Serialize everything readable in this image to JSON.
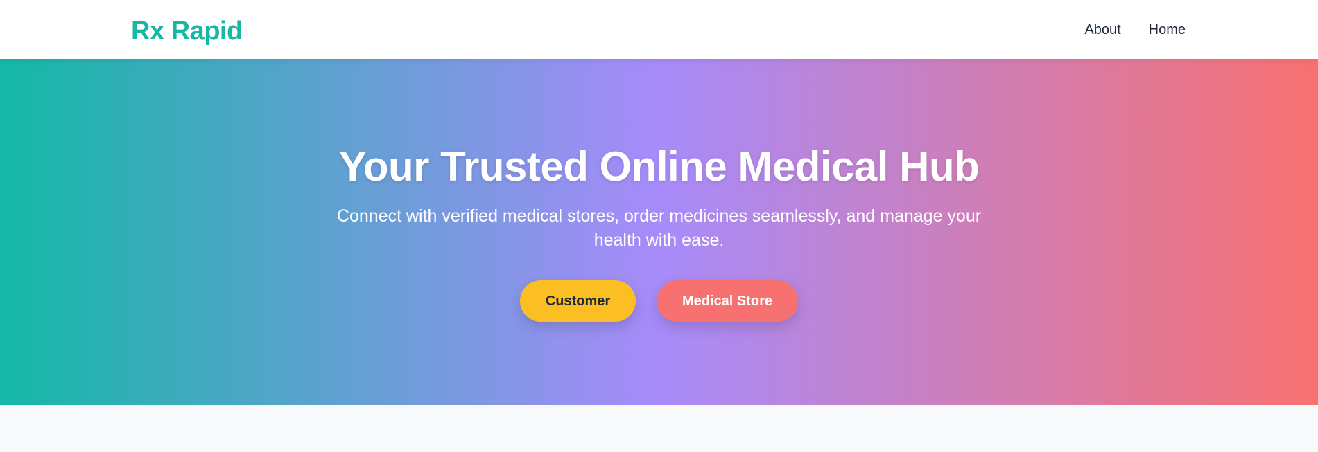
{
  "navbar": {
    "brand": "Rx Rapid",
    "links": [
      {
        "label": "About"
      },
      {
        "label": "Home"
      }
    ]
  },
  "hero": {
    "title": "Your Trusted Online Medical Hub",
    "subtitle": "Connect with verified medical stores, order medicines seamlessly, and manage your health with ease.",
    "buttons": {
      "customer_label": "Customer",
      "store_label": "Medical Store"
    }
  },
  "colors": {
    "brand": "#16b7a3",
    "gradient_start": "#14b8a6",
    "gradient_mid": "#a78bfa",
    "gradient_end": "#f87171",
    "customer_button": "#fbbf24",
    "store_button": "#f87171",
    "page_background": "#f8f9fb"
  }
}
